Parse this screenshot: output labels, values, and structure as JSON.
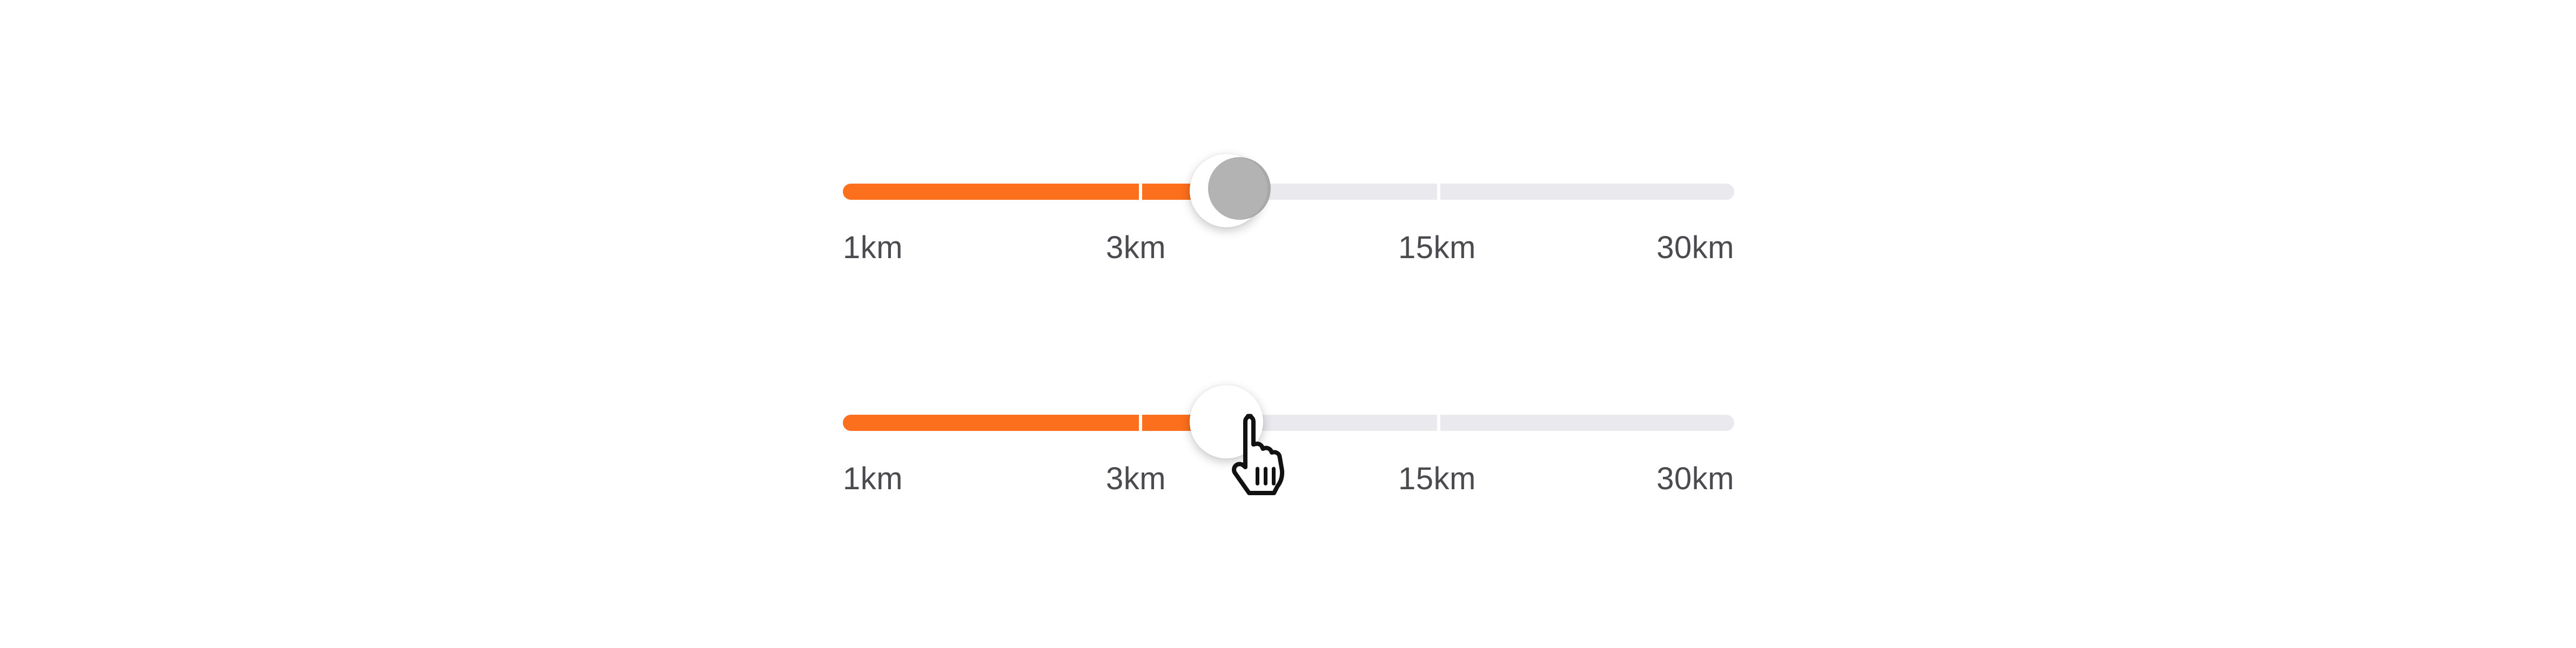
{
  "sliders": [
    {
      "state": "pressed",
      "selected_fraction": 0.43,
      "labels": [
        "1km",
        "3km",
        "15km",
        "30km"
      ]
    },
    {
      "state": "hover",
      "selected_fraction": 0.43,
      "labels": [
        "1km",
        "3km",
        "15km",
        "30km"
      ]
    }
  ],
  "colors": {
    "fill": "#fc6f1c",
    "track": "#e9e9ee",
    "label": "#4a4a4f",
    "pressed_thumb": "#b3b3b3"
  },
  "icons": {
    "cursor": "hand-pointer-icon"
  }
}
